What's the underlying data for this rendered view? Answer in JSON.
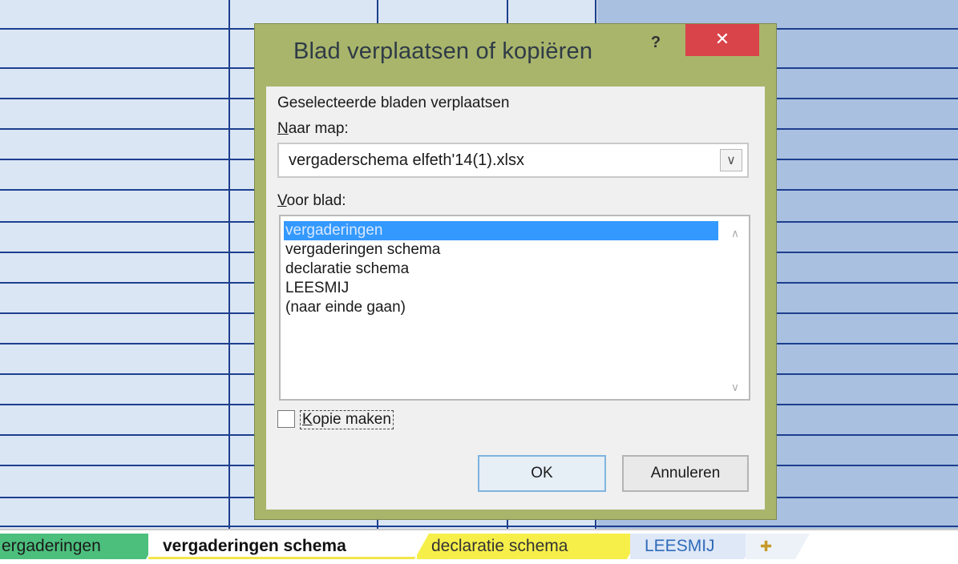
{
  "dialog": {
    "title": "Blad verplaatsen of kopiëren",
    "help_label": "?",
    "close_label": "✕",
    "selected_sheets_text": "Geselecteerde bladen verplaatsen",
    "to_book_label_accel": "N",
    "to_book_label_rest": "aar map:",
    "to_book_value": "vergaderschema elfeth'14(1).xlsx",
    "before_sheet_label_accel": "V",
    "before_sheet_label_rest": "oor blad:",
    "before_sheet_items": [
      "vergaderingen",
      "vergaderingen schema",
      "declaratie schema",
      "LEESMIJ",
      "(naar einde gaan)"
    ],
    "selected_index": 0,
    "copy_label_accel": "K",
    "copy_label_rest": "opie maken",
    "copy_checked": false,
    "ok_label": "OK",
    "cancel_label": "Annuleren"
  },
  "sheet_tabs": {
    "tab1": "ergaderingen",
    "tab2": "vergaderingen schema",
    "tab3": "declaratie schema",
    "tab4": "LEESMIJ",
    "add_symbol": "✚"
  },
  "colors": {
    "title_bar": "#a9b56b",
    "close_button": "#d9434a",
    "selection": "#3399ff",
    "grid_lines": "#1d3f8e",
    "tab_green": "#4cbf7d",
    "tab_yellow": "#f6ef4a"
  }
}
